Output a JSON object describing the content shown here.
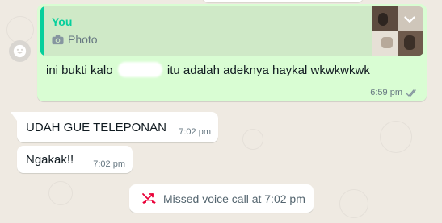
{
  "colors": {
    "background": "#efeae2",
    "outgoing_bubble": "#d9fdd3",
    "quote_accent": "#06cf9c",
    "incoming_bubble": "#ffffff",
    "read_ticks": "#8696a0",
    "missed_call": "#ea0038"
  },
  "outgoing_message": {
    "quote": {
      "author": "You",
      "type_icon": "camera-icon",
      "type_label": "Photo"
    },
    "text_before": "ini bukti kalo",
    "text_after": "itu adalah adeknya haykal wkwkwkwk",
    "time": "6:59 pm",
    "status_icon": "double-check-icon"
  },
  "incoming_messages": [
    {
      "text": "UDAH GUE TELEPONAN",
      "time": "7:02 pm"
    },
    {
      "text": "Ngakak!!",
      "time": "7:02 pm"
    }
  ],
  "system_message": {
    "icon": "missed-call-icon",
    "text": "Missed voice call at 7:02 pm"
  },
  "react_icon": "smiley-icon"
}
